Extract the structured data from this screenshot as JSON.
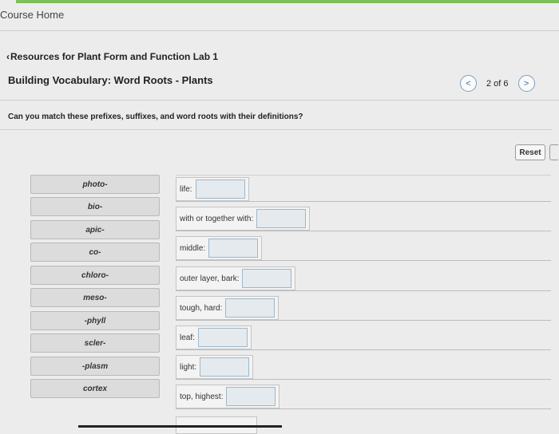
{
  "header": {
    "course_home": "Course Home"
  },
  "breadcrumb": {
    "text": "Resources for Plant Form and Function Lab 1"
  },
  "page": {
    "title": "Building Vocabulary: Word Roots - Plants"
  },
  "pager": {
    "prev": "<",
    "count": "2 of 6",
    "next": ">"
  },
  "question": "Can you match these prefixes, suffixes, and word roots with their definitions?",
  "reset_label": "Reset",
  "terms": [
    "photo-",
    "bio-",
    "apic-",
    "co-",
    "chloro-",
    "meso-",
    "-phyll",
    "scler-",
    "-plasm",
    "cortex"
  ],
  "definitions": [
    "life:",
    "with or together with:",
    "middle:",
    "outer layer, bark:",
    "tough, hard:",
    "leaf:",
    "light:",
    "top, highest:"
  ],
  "colors": {
    "accent": "#7fbf5a",
    "link": "#3a6ea5"
  }
}
